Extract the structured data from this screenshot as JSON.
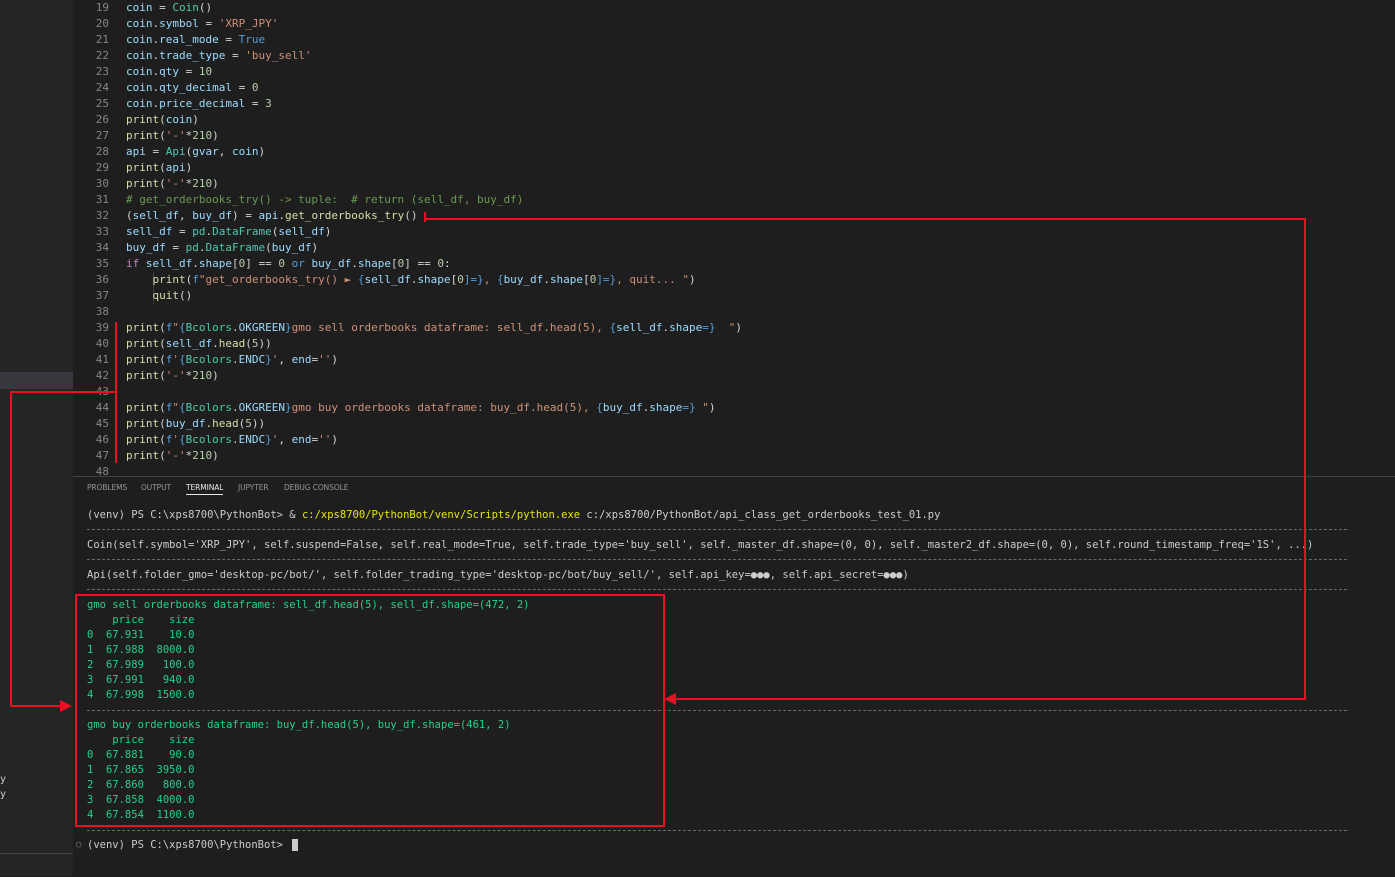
{
  "sidebar": {
    "fragments": [
      "y",
      "y"
    ]
  },
  "editor": {
    "line_numbers": [
      "19",
      "20",
      "21",
      "22",
      "23",
      "24",
      "25",
      "26",
      "27",
      "28",
      "29",
      "30",
      "31",
      "32",
      "33",
      "34",
      "35",
      "36",
      "37",
      "38",
      "39",
      "40",
      "41",
      "42",
      "43",
      "44",
      "45",
      "46",
      "47",
      "48"
    ],
    "l19": {
      "a": "coin",
      "b": " = ",
      "c": "Coin",
      "d": "()"
    },
    "l20": {
      "a": "coin",
      "b": ".",
      "c": "symbol",
      "d": " = ",
      "e": "'XRP_JPY'"
    },
    "l21": {
      "a": "coin",
      "b": ".",
      "c": "real_mode",
      "d": " = ",
      "e": "True"
    },
    "l22": {
      "a": "coin",
      "b": ".",
      "c": "trade_type",
      "d": " = ",
      "e": "'buy_sell'"
    },
    "l23": {
      "a": "coin",
      "b": ".",
      "c": "qty",
      "d": " = ",
      "e": "10"
    },
    "l24": {
      "a": "coin",
      "b": ".",
      "c": "qty_decimal",
      "d": " = ",
      "e": "0"
    },
    "l25": {
      "a": "coin",
      "b": ".",
      "c": "price_decimal",
      "d": " = ",
      "e": "3"
    },
    "l26": {
      "a": "print",
      "b": "(",
      "c": "coin",
      "d": ")"
    },
    "l27": {
      "a": "print",
      "b": "(",
      "c": "'-'",
      "d": "*",
      "e": "210",
      "f": ")"
    },
    "l28": {
      "a": "api",
      "b": " = ",
      "c": "Api",
      "d": "(",
      "e": "gvar",
      "f": ", ",
      "g": "coin",
      "h": ")"
    },
    "l29": {
      "a": "print",
      "b": "(",
      "c": "api",
      "d": ")"
    },
    "l30": {
      "a": "print",
      "b": "(",
      "c": "'-'",
      "d": "*",
      "e": "210",
      "f": ")"
    },
    "l31": {
      "a": "# get_orderbooks_try() -> tuple:  # return (sell_df, buy_df)"
    },
    "l32": {
      "a": "(",
      "b": "sell_df",
      "c": ", ",
      "d": "buy_df",
      "e": ") = ",
      "f": "api",
      "g": ".",
      "h": "get_orderbooks_try",
      "i": "()"
    },
    "l33": {
      "a": "sell_df",
      "b": " = ",
      "c": "pd",
      "d": ".",
      "e": "DataFrame",
      "f": "(",
      "g": "sell_df",
      "h": ")"
    },
    "l34": {
      "a": "buy_df",
      "b": " = ",
      "c": "pd",
      "d": ".",
      "e": "DataFrame",
      "f": "(",
      "g": "buy_df",
      "h": ")"
    },
    "l35": {
      "a": "if ",
      "b": "sell_df",
      "c": ".",
      "d": "shape",
      "e": "[",
      "f": "0",
      "g": "] == ",
      "h": "0",
      "i": " or ",
      "j": "buy_df",
      "k": ".",
      "l": "shape",
      "m": "[",
      "n": "0",
      "o": "] == ",
      "p": "0",
      "q": ":"
    },
    "l36": {
      "a": "    ",
      "b": "print",
      "c": "(",
      "d": "f",
      "e": "\"get_orderbooks_try() ► ",
      "f": "{",
      "g": "sell_df",
      "h": ".",
      "i": "shape",
      "j": "[",
      "k": "0",
      "l": "]=}",
      "m": ", ",
      "n": "{",
      "o": "buy_df",
      "p": ".",
      "q": "shape",
      "r": "[",
      "s": "0",
      "t": "]=}",
      "u": ", quit... \"",
      "v": ")"
    },
    "l37": {
      "a": "    ",
      "b": "quit",
      "c": "()"
    },
    "l39": {
      "a": "print",
      "b": "(",
      "c": "f",
      "d": "\"",
      "e": "{",
      "f": "Bcolors",
      "g": ".",
      "h": "OKGREEN",
      "i": "}",
      "j": "gmo sell orderbooks dataframe: sell_df.head(5), ",
      "k": "{",
      "l": "sell_df",
      "m": ".",
      "n": "shape",
      "o": "=}",
      "p": "  \"",
      "q": ")"
    },
    "l40": {
      "a": "print",
      "b": "(",
      "c": "sell_df",
      "d": ".",
      "e": "head",
      "f": "(",
      "g": "5",
      "h": "))"
    },
    "l41": {
      "a": "print",
      "b": "(",
      "c": "f",
      "d": "'",
      "e": "{",
      "f": "Bcolors",
      "g": ".",
      "h": "ENDC",
      "i": "}",
      "j": "'",
      "k": ", ",
      "l": "end",
      "m": "=",
      "n": "''",
      "o": ")"
    },
    "l42": {
      "a": "print",
      "b": "(",
      "c": "'-'",
      "d": "*",
      "e": "210",
      "f": ")"
    },
    "l44": {
      "a": "print",
      "b": "(",
      "c": "f",
      "d": "\"",
      "e": "{",
      "f": "Bcolors",
      "g": ".",
      "h": "OKGREEN",
      "i": "}",
      "j": "gmo buy orderbooks dataframe: buy_df.head(5), ",
      "k": "{",
      "l": "buy_df",
      "m": ".",
      "n": "shape",
      "o": "=}",
      "p": " \"",
      "q": ")"
    },
    "l45": {
      "a": "print",
      "b": "(",
      "c": "buy_df",
      "d": ".",
      "e": "head",
      "f": "(",
      "g": "5",
      "h": "))"
    },
    "l46": {
      "a": "print",
      "b": "(",
      "c": "f",
      "d": "'",
      "e": "{",
      "f": "Bcolors",
      "g": ".",
      "h": "ENDC",
      "i": "}",
      "j": "'",
      "k": ", ",
      "l": "end",
      "m": "=",
      "n": "''",
      "o": ")"
    },
    "l47": {
      "a": "print",
      "b": "(",
      "c": "'-'",
      "d": "*",
      "e": "210",
      "f": ")"
    }
  },
  "panel": {
    "tabs": [
      "PROBLEMS",
      "OUTPUT",
      "TERMINAL",
      "JUPYTER",
      "DEBUG CONSOLE"
    ],
    "active_tab": "TERMINAL"
  },
  "terminal": {
    "cmd_prompt": "(venv) PS C:\\xps8700\\PythonBot> ",
    "cmd_amp": "& ",
    "cmd_exe": "c:/xps8700/PythonBot/venv/Scripts/python.exe",
    "cmd_arg": " c:/xps8700/PythonBot/api_class_get_orderbooks_test_01.py",
    "coin_repr": "Coin(self.symbol='XRP_JPY', self.suspend=False, self.real_mode=True, self.trade_type='buy_sell', self._master_df.shape=(0, 0), self._master2_df.shape=(0, 0), self.round_timestamp_freq='1S', ...)",
    "api_repr": "Api(self.folder_gmo='desktop-pc/bot/', self.folder_trading_type='desktop-pc/bot/buy_sell/', self.api_key=●●●, self.api_secret=●●●)",
    "sell_header": "gmo sell orderbooks dataframe: sell_df.head(5), sell_df.shape=(472, 2)",
    "sell_rows": [
      "    price    size",
      "0  67.931    10.0",
      "1  67.988  8000.0",
      "2  67.989   100.0",
      "3  67.991   940.0",
      "4  67.998  1500.0"
    ],
    "buy_header": "gmo buy orderbooks dataframe: buy_df.head(5), buy_df.shape=(461, 2)",
    "buy_rows": [
      "    price    size",
      "0  67.881    90.0",
      "1  67.865  3950.0",
      "2  67.860   800.0",
      "3  67.858  4000.0",
      "4  67.854  1100.0"
    ],
    "final_prompt": "(venv) PS C:\\xps8700\\PythonBot> "
  },
  "colors": {
    "annotation_red": "#e81123",
    "terminal_green": "#23d18b",
    "terminal_yellow": "#e5e510"
  }
}
